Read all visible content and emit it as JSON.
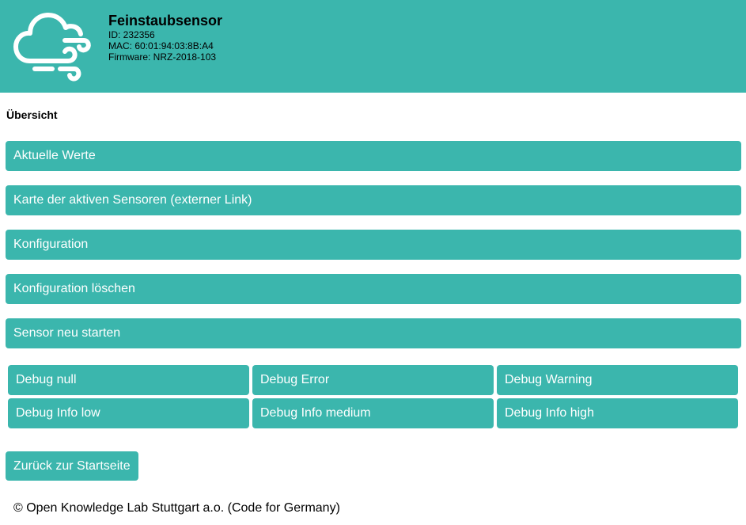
{
  "header": {
    "title": "Feinstaubsensor",
    "id_line": "ID: 232356",
    "mac_line": "MAC: 60:01:94:03:8B:A4",
    "firmware_line": "Firmware: NRZ-2018-103",
    "logo_icon": "cloud-wind-icon",
    "accent_color": "#3bb6ad"
  },
  "main": {
    "section_title": "Übersicht",
    "menu": [
      "Aktuelle Werte",
      "Karte der aktiven Sensoren (externer Link)",
      "Konfiguration",
      "Konfiguration löschen",
      "Sensor neu starten"
    ],
    "debug": [
      "Debug null",
      "Debug Error",
      "Debug Warning",
      "Debug Info low",
      "Debug Info medium",
      "Debug Info high"
    ],
    "back_button": "Zurück zur Startseite"
  },
  "footer": {
    "text": "© Open Knowledge Lab Stuttgart a.o. (Code for Germany)"
  }
}
